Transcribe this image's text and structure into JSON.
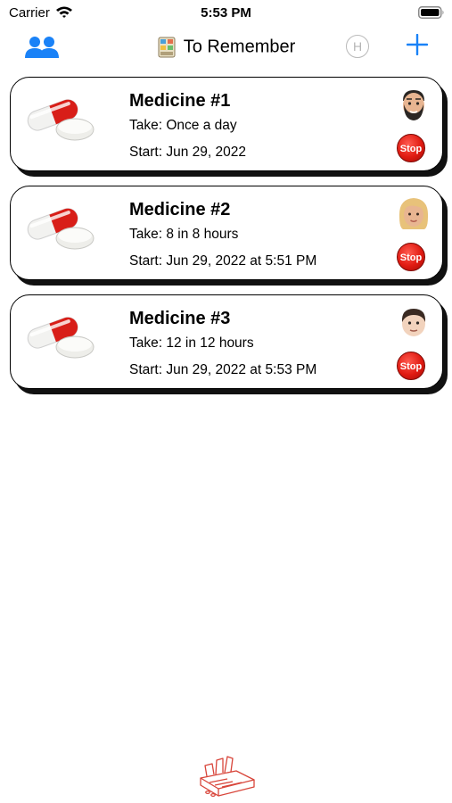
{
  "status_bar": {
    "carrier": "Carrier",
    "time": "5:53 PM"
  },
  "nav": {
    "title": "To Remember",
    "h_label": "H",
    "left_icon": "people-icon",
    "right_icon": "plus-icon"
  },
  "medicines": [
    {
      "name": "Medicine #1",
      "take": "Take: Once a day",
      "start": "Start: Jun 29, 2022",
      "avatar": "bearded-man-emoji",
      "stop_label": "Stop"
    },
    {
      "name": "Medicine #2",
      "take": "Take: 8 in 8 hours",
      "start": "Start: Jun 29, 2022 at 5:51 PM",
      "avatar": "blonde-woman-emoji",
      "stop_label": "Stop"
    },
    {
      "name": "Medicine #3",
      "take": "Take: 12 in 12 hours",
      "start": "Start: Jun 29, 2022 at 5:53 PM",
      "avatar": "boy-emoji",
      "stop_label": "Stop"
    }
  ],
  "colors": {
    "accent": "#1a82f7",
    "stop_red": "#e01b12",
    "logo_red": "#d8453a"
  }
}
